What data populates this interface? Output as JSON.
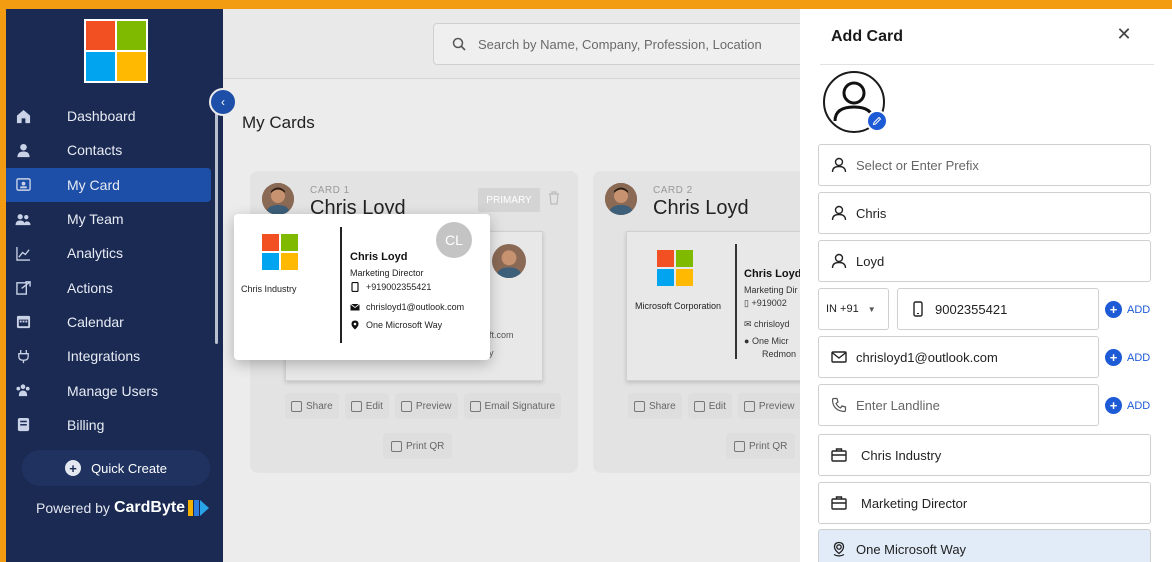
{
  "sidebar": {
    "items": [
      {
        "label": "Dashboard",
        "icon": "home-icon"
      },
      {
        "label": "Contacts",
        "icon": "person-icon"
      },
      {
        "label": "My Card",
        "icon": "id-card-icon"
      },
      {
        "label": "My Team",
        "icon": "team-icon"
      },
      {
        "label": "Analytics",
        "icon": "chart-icon"
      },
      {
        "label": "Actions",
        "icon": "actions-icon"
      },
      {
        "label": "Calendar",
        "icon": "calendar-icon"
      },
      {
        "label": "Integrations",
        "icon": "plug-icon"
      },
      {
        "label": "Manage Users",
        "icon": "users-icon"
      },
      {
        "label": "Billing",
        "icon": "billing-icon"
      }
    ],
    "quick_create": "Quick Create",
    "powered_prefix": "Powered by",
    "powered_brand": "CardByte"
  },
  "header": {
    "search_placeholder": "Search by Name, Company, Profession, Location"
  },
  "main": {
    "title": "My Cards",
    "cards": [
      {
        "label": "CARD 1",
        "name": "Chris Loyd",
        "badge": "PRIMARY",
        "partial_email": "oft.com",
        "partial_address": "ay"
      },
      {
        "label": "CARD 2",
        "name": "Chris Loyd",
        "company": "Microsoft Corporation",
        "person": "Chris Loyd",
        "role_partial": "Marketing Dir",
        "phone_partial": "+919002",
        "email_partial": "chrisloyd",
        "address_partial": "One Micr",
        "city_partial": "Redmon"
      }
    ],
    "actions": {
      "share": "Share",
      "edit": "Edit",
      "preview": "Preview",
      "email_signature": "Email Signature",
      "print_qr": "Print QR"
    }
  },
  "popup": {
    "company": "Chris Industry",
    "initials": "CL",
    "name": "Chris Loyd",
    "role": "Marketing Director",
    "phone": "+919002355421",
    "email": "chrisloyd1@outlook.com",
    "address": "One Microsoft Way"
  },
  "panel": {
    "title": "Add Card",
    "prefix_placeholder": "Select or Enter Prefix",
    "first_name": "Chris",
    "last_name": "Loyd",
    "country_code": "IN +91",
    "phone": "9002355421",
    "email": "chrisloyd1@outlook.com",
    "landline_placeholder": "Enter Landline",
    "company": "Chris Industry",
    "designation": "Marketing Director",
    "address": "One Microsoft Way",
    "add_label": "ADD"
  },
  "colors": {
    "sidebar_bg": "#1b2a52",
    "active_item": "#1d4fa8",
    "accent_blue": "#1d5ad6",
    "frame_orange": "#f39c12",
    "ms_red": "#f25022",
    "ms_green": "#7fba00",
    "ms_blue": "#00a4ef",
    "ms_yellow": "#ffb900"
  }
}
